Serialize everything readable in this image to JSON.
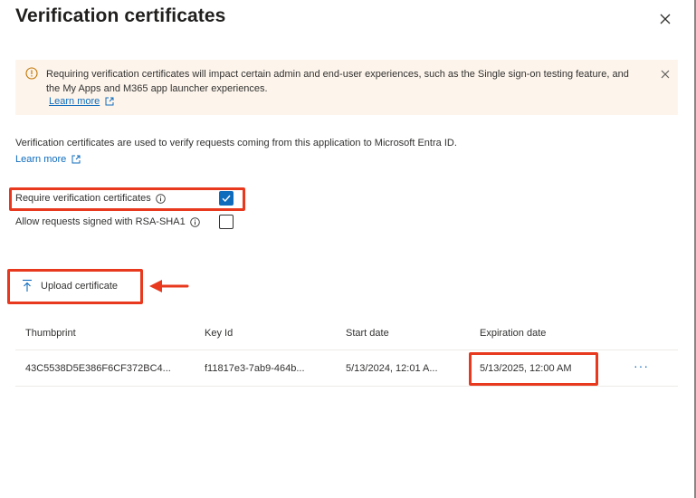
{
  "panel": {
    "title": "Verification certificates"
  },
  "banner": {
    "text": "Requiring verification certificates will impact certain admin and end-user experiences, such as the Single sign-on testing feature, and the My Apps and M365 app launcher experiences.",
    "link_label": "Learn more"
  },
  "description": {
    "text": "Verification certificates are used to verify requests coming from this application to Microsoft Entra ID.",
    "link_label": "Learn more"
  },
  "options": [
    {
      "label": "Require verification certificates",
      "checked": true
    },
    {
      "label": "Allow requests signed with RSA-SHA1",
      "checked": false
    }
  ],
  "toolbar": {
    "upload_label": "Upload certificate"
  },
  "table": {
    "columns": [
      "Thumbprint",
      "Key Id",
      "Start date",
      "Expiration date"
    ],
    "rows": [
      [
        "43C5538D5E386F6CF372BC4...",
        "f11817e3-7ab9-464b...",
        "5/13/2024, 12:01 A...",
        "5/13/2025, 12:00 AM"
      ]
    ],
    "row_menu_label": "···"
  },
  "colors": {
    "accent": "#0f6cbd",
    "banner_bg": "#fdf5ec",
    "warning": "#c27400",
    "highlight": "#e8391e"
  },
  "icons": {
    "close": "close-icon",
    "warning": "warning-icon",
    "external_link": "external-link-icon",
    "info": "info-icon",
    "checkmark": "checkmark-icon",
    "upload": "upload-icon",
    "arrow": "arrow-left-icon"
  }
}
